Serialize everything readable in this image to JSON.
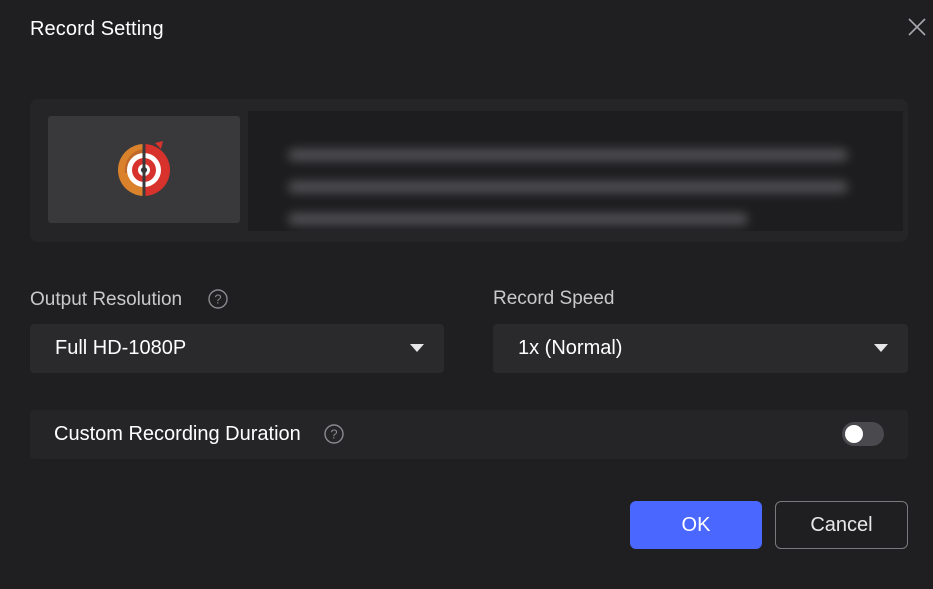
{
  "dialog": {
    "title": "Record Setting"
  },
  "preview": {
    "app_icon": "recorder-app-icon",
    "description_blurred": true
  },
  "output_resolution": {
    "label": "Output Resolution",
    "value": "Full HD-1080P"
  },
  "record_speed": {
    "label": "Record Speed",
    "value": "1x (Normal)"
  },
  "custom_duration": {
    "label": "Custom Recording Duration",
    "enabled": false
  },
  "buttons": {
    "ok": "OK",
    "cancel": "Cancel"
  },
  "colors": {
    "background": "#1f1f21",
    "panel": "#252528",
    "accent": "#4a68ff",
    "toggle_off": "#4a4a4e"
  },
  "icons": {
    "close": "close-icon",
    "help": "question-circle-icon",
    "dropdown": "caret-down-icon"
  }
}
